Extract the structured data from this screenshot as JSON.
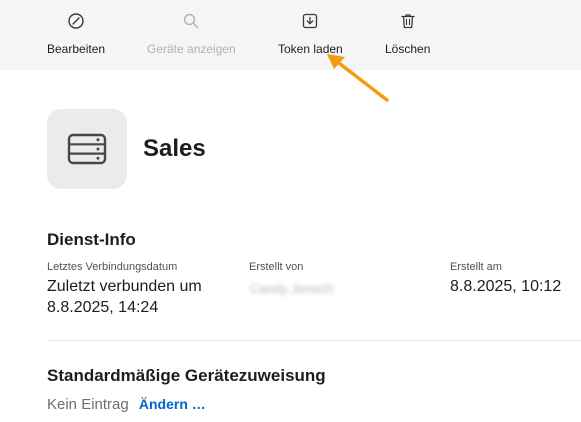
{
  "toolbar": {
    "edit_label": "Bearbeiten",
    "show_devices_label": "Geräte anzeigen",
    "load_token_label": "Token laden",
    "delete_label": "Löschen"
  },
  "annotation_color": "#f39c12",
  "service": {
    "name": "Sales",
    "icon": "server-icon"
  },
  "service_info": {
    "heading": "Dienst-Info",
    "last_connection_label": "Letztes Verbindungsdatum",
    "last_connection_value": "Zuletzt verbunden um 8.8.2025, 14:24",
    "created_by_label": "Erstellt von",
    "created_by_value": "Candy Jenach",
    "created_at_label": "Erstellt am",
    "created_at_value": "8.8.2025, 10:12"
  },
  "default_assignment": {
    "heading": "Standardmäßige Gerätezuweisung",
    "value": "Kein Eintrag",
    "change_link": "Ändern …"
  }
}
